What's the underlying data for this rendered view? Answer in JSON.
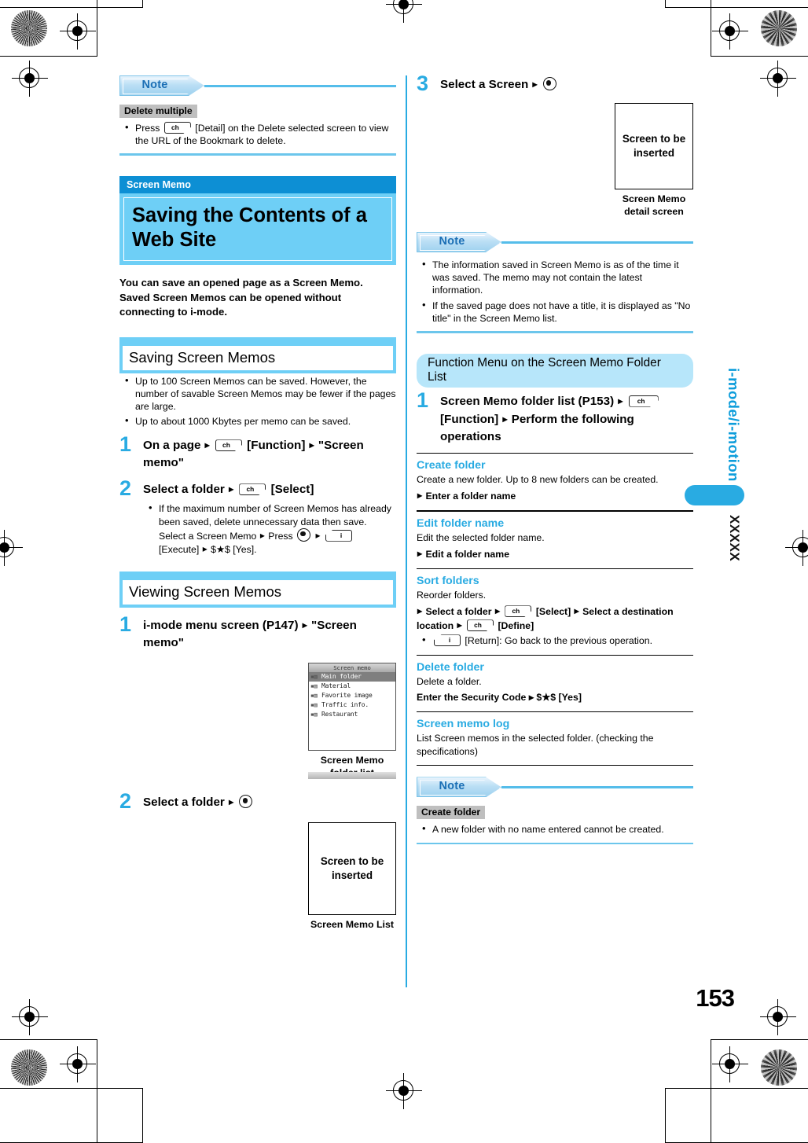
{
  "page": {
    "number": "153",
    "side_tab_label": "i-mode/i-motion",
    "side_tab_code": "XXXXX"
  },
  "left_column": {
    "note_top": {
      "banner_label": "Note",
      "tag": "Delete multiple",
      "items": [
        "Press [KEY:ch] [Detail] on the Delete selected screen to view the URL of the Bookmark to delete."
      ],
      "item_parts": [
        {
          "pre": "Press ",
          "key": "ch",
          "post": " [Detail] on the Delete selected screen to view the URL of the Bookmark to delete."
        }
      ]
    },
    "chapter": {
      "eyebrow": "Screen Memo",
      "title": "Saving the Contents of a Web Site",
      "lead": "You can save an opened page as a Screen Memo. Saved Screen Memos can be opened without connecting to i-mode."
    },
    "section_saving": {
      "heading": "Saving Screen Memos",
      "bullets": [
        "Up to 100 Screen Memos can be saved. However, the number of savable Screen Memos may be fewer if the pages are large.",
        "Up to about 1000 Kbytes per memo can be saved."
      ],
      "step1": {
        "number": "1",
        "pre": "On a page",
        "key": "ch",
        "mid": "[Function]",
        "post": "\"Screen memo\""
      },
      "step2": {
        "number": "2",
        "pre": "Select a folder",
        "key": "ch",
        "post": "[Select]",
        "note_pre": "If the maximum number of Screen Memos has already been saved, delete unnecessary data then save. Select a Screen Memo ",
        "note_press": "Press ",
        "note_key": "i",
        "note_mid": "[Execute]",
        "note_post": "$★$ [Yes]."
      }
    },
    "section_viewing": {
      "heading": "Viewing Screen Memos",
      "step1": {
        "number": "1",
        "pre": "i-mode menu screen (P147)",
        "post": "\"Screen memo\""
      },
      "figure_folder_list": {
        "screen_title": "Screen memo",
        "rows": [
          {
            "icon": "folder-icon",
            "label": "Main folder",
            "selected": true
          },
          {
            "icon": "folder-icon",
            "label": "Material",
            "selected": false
          },
          {
            "icon": "folder-icon",
            "label": "Favorite image",
            "selected": false
          },
          {
            "icon": "folder-icon",
            "label": "Traffic info.",
            "selected": false
          },
          {
            "icon": "folder-icon",
            "label": "Restaurant",
            "selected": false
          }
        ],
        "caption": "Screen Memo folder list"
      },
      "step2": {
        "number": "2",
        "pre": "Select a folder"
      },
      "figure_memo_list": {
        "placeholder": "Screen to be inserted",
        "caption": "Screen Memo List"
      }
    }
  },
  "right_column": {
    "step3": {
      "number": "3",
      "pre": "Select a Screen"
    },
    "figure_detail": {
      "placeholder": "Screen to be inserted",
      "caption": "Screen Memo detail screen"
    },
    "note_mid": {
      "banner_label": "Note",
      "items": [
        "The information saved in Screen Memo is as of the time it was saved. The memo may not contain the latest information.",
        "If the saved page does not have a title, it is displayed as \"No title\" in the Screen Memo list."
      ]
    },
    "function_menu": {
      "pill_label": "Function Menu on the Screen Memo Folder List",
      "step1": {
        "number": "1",
        "pre": "Screen Memo folder list (P153)",
        "key": "ch",
        "mid": "[Function]",
        "post": "Perform the following operations"
      },
      "entries": [
        {
          "title": "Create folder",
          "desc": "Create a new folder. Up to 8 new folders can be created.",
          "ops": [
            "Enter a folder name"
          ],
          "sub": []
        },
        {
          "title": "Edit folder name",
          "desc": "Edit the selected folder name.",
          "ops": [
            "Edit a folder name"
          ],
          "sub": []
        },
        {
          "title": "Sort folders",
          "desc": "Reorder folders.",
          "ops": [],
          "sub": []
        },
        {
          "title": "Delete folder",
          "desc": "Delete a folder.",
          "ops": [],
          "sub": []
        },
        {
          "title": "Screen memo log",
          "desc": "List Screen memos in the selected folder. (checking the specifications)",
          "ops": [],
          "sub": []
        }
      ],
      "sort_op_pre": "Select a folder",
      "sort_op_key1": "ch",
      "sort_op_mid": "[Select]",
      "sort_op_mid2": "Select a destination location",
      "sort_op_key2": "ch",
      "sort_op_end": "[Define]",
      "sort_sub_key": "i",
      "sort_sub_text": "[Return]: Go back to the previous operation.",
      "delete_op": "Enter the Security Code ▸ $★$ [Yes]"
    },
    "note_bottom": {
      "banner_label": "Note",
      "tag": "Create folder",
      "items": [
        "A new folder with no name entered cannot be created."
      ]
    }
  },
  "icons": {
    "ch_key": "ch",
    "i_key": "i",
    "ok_key": "center-select-key",
    "arrow": "▸"
  },
  "colors": {
    "accent_blue": "#29abe2",
    "chapter_bar": "#0d8fd4",
    "chapter_body": "#6ecff6",
    "note_rule": "#55bdea",
    "tag_gray": "#bfbfbf"
  }
}
